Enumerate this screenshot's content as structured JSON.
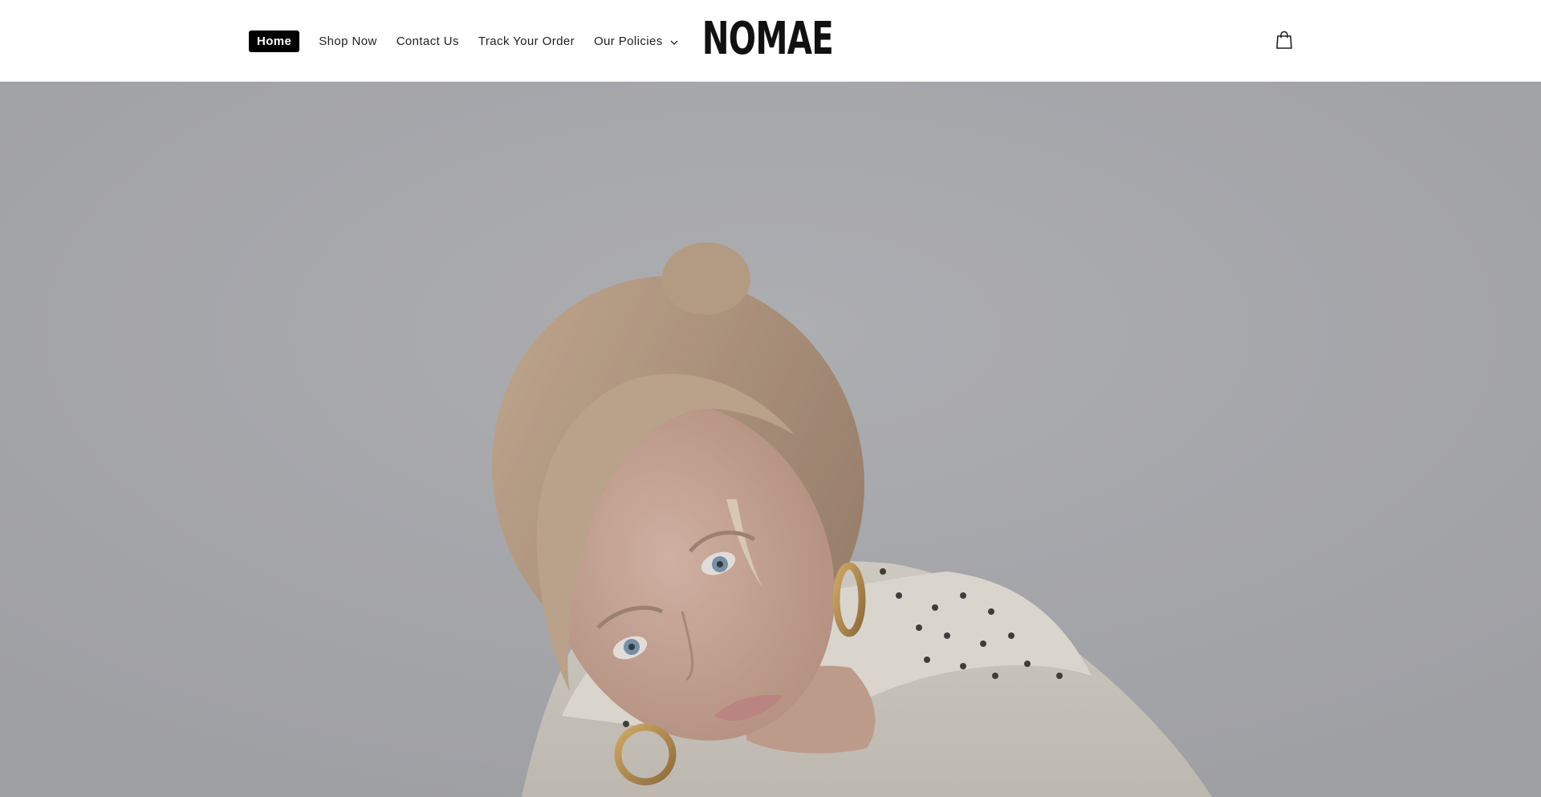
{
  "nav": {
    "items": [
      {
        "label": "Home",
        "active": true
      },
      {
        "label": "Shop Now",
        "active": false
      },
      {
        "label": "Contact Us",
        "active": false
      },
      {
        "label": "Track Your Order",
        "active": false
      },
      {
        "label": "Our Policies",
        "active": false,
        "has_dropdown": true
      }
    ]
  },
  "brand": {
    "logo_text": "NOMAE"
  },
  "header_icons": {
    "cart": "shopping-bag-icon"
  },
  "hero": {
    "image": "model-portrait-photo"
  },
  "colors": {
    "header_bg": "#ffffff",
    "active_nav_bg": "#000000",
    "active_nav_text": "#ffffff",
    "text": "#1f1f1f"
  }
}
